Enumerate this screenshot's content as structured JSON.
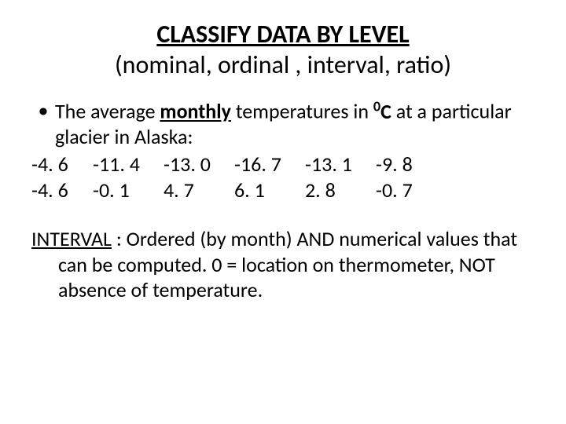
{
  "title": "CLASSIFY DATA BY LEVEL",
  "subtitle": "(nominal, ordinal , interval, ratio)",
  "bullet": {
    "pre": "The average ",
    "monthly": "monthly",
    "mid": " temperatures in ",
    "sup": "0",
    "unit": "C",
    "post": " at a particular glacier in Alaska:"
  },
  "rows": [
    [
      "-4. 6",
      "-11. 4",
      "-13. 0",
      "-16. 7",
      "-13. 1",
      "-9. 8"
    ],
    [
      "-4. 6",
      "-0. 1",
      "  4. 7",
      "  6. 1",
      "  2. 8",
      "-0. 7"
    ]
  ],
  "explain": {
    "label": "INTERVAL",
    "rest": " : Ordered (by month) AND numerical values that can be computed.  0 = location on thermometer, NOT absence of temperature."
  }
}
